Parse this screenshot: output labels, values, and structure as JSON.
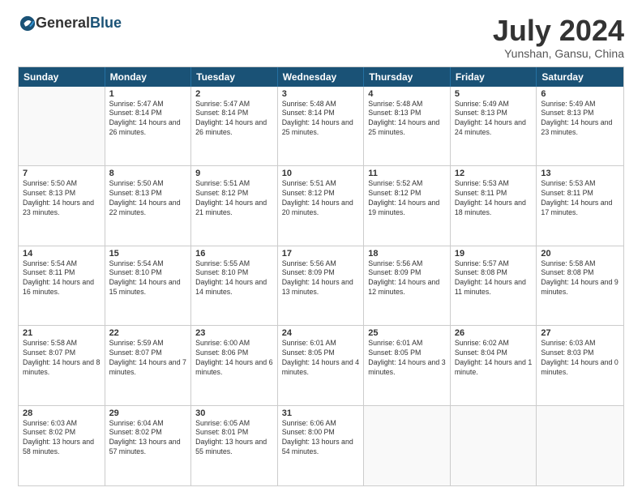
{
  "logo": {
    "general": "General",
    "blue": "Blue"
  },
  "title": "July 2024",
  "location": "Yunshan, Gansu, China",
  "days_of_week": [
    "Sunday",
    "Monday",
    "Tuesday",
    "Wednesday",
    "Thursday",
    "Friday",
    "Saturday"
  ],
  "weeks": [
    [
      {
        "day": "",
        "empty": true
      },
      {
        "day": "1",
        "sunrise": "5:47 AM",
        "sunset": "8:14 PM",
        "daylight": "14 hours and 26 minutes."
      },
      {
        "day": "2",
        "sunrise": "5:47 AM",
        "sunset": "8:14 PM",
        "daylight": "14 hours and 26 minutes."
      },
      {
        "day": "3",
        "sunrise": "5:48 AM",
        "sunset": "8:14 PM",
        "daylight": "14 hours and 25 minutes."
      },
      {
        "day": "4",
        "sunrise": "5:48 AM",
        "sunset": "8:13 PM",
        "daylight": "14 hours and 25 minutes."
      },
      {
        "day": "5",
        "sunrise": "5:49 AM",
        "sunset": "8:13 PM",
        "daylight": "14 hours and 24 minutes."
      },
      {
        "day": "6",
        "sunrise": "5:49 AM",
        "sunset": "8:13 PM",
        "daylight": "14 hours and 23 minutes."
      }
    ],
    [
      {
        "day": "7",
        "sunrise": "5:50 AM",
        "sunset": "8:13 PM",
        "daylight": "14 hours and 23 minutes."
      },
      {
        "day": "8",
        "sunrise": "5:50 AM",
        "sunset": "8:13 PM",
        "daylight": "14 hours and 22 minutes."
      },
      {
        "day": "9",
        "sunrise": "5:51 AM",
        "sunset": "8:12 PM",
        "daylight": "14 hours and 21 minutes."
      },
      {
        "day": "10",
        "sunrise": "5:51 AM",
        "sunset": "8:12 PM",
        "daylight": "14 hours and 20 minutes."
      },
      {
        "day": "11",
        "sunrise": "5:52 AM",
        "sunset": "8:12 PM",
        "daylight": "14 hours and 19 minutes."
      },
      {
        "day": "12",
        "sunrise": "5:53 AM",
        "sunset": "8:11 PM",
        "daylight": "14 hours and 18 minutes."
      },
      {
        "day": "13",
        "sunrise": "5:53 AM",
        "sunset": "8:11 PM",
        "daylight": "14 hours and 17 minutes."
      }
    ],
    [
      {
        "day": "14",
        "sunrise": "5:54 AM",
        "sunset": "8:11 PM",
        "daylight": "14 hours and 16 minutes."
      },
      {
        "day": "15",
        "sunrise": "5:54 AM",
        "sunset": "8:10 PM",
        "daylight": "14 hours and 15 minutes."
      },
      {
        "day": "16",
        "sunrise": "5:55 AM",
        "sunset": "8:10 PM",
        "daylight": "14 hours and 14 minutes."
      },
      {
        "day": "17",
        "sunrise": "5:56 AM",
        "sunset": "8:09 PM",
        "daylight": "14 hours and 13 minutes."
      },
      {
        "day": "18",
        "sunrise": "5:56 AM",
        "sunset": "8:09 PM",
        "daylight": "14 hours and 12 minutes."
      },
      {
        "day": "19",
        "sunrise": "5:57 AM",
        "sunset": "8:08 PM",
        "daylight": "14 hours and 11 minutes."
      },
      {
        "day": "20",
        "sunrise": "5:58 AM",
        "sunset": "8:08 PM",
        "daylight": "14 hours and 9 minutes."
      }
    ],
    [
      {
        "day": "21",
        "sunrise": "5:58 AM",
        "sunset": "8:07 PM",
        "daylight": "14 hours and 8 minutes."
      },
      {
        "day": "22",
        "sunrise": "5:59 AM",
        "sunset": "8:07 PM",
        "daylight": "14 hours and 7 minutes."
      },
      {
        "day": "23",
        "sunrise": "6:00 AM",
        "sunset": "8:06 PM",
        "daylight": "14 hours and 6 minutes."
      },
      {
        "day": "24",
        "sunrise": "6:01 AM",
        "sunset": "8:05 PM",
        "daylight": "14 hours and 4 minutes."
      },
      {
        "day": "25",
        "sunrise": "6:01 AM",
        "sunset": "8:05 PM",
        "daylight": "14 hours and 3 minutes."
      },
      {
        "day": "26",
        "sunrise": "6:02 AM",
        "sunset": "8:04 PM",
        "daylight": "14 hours and 1 minute."
      },
      {
        "day": "27",
        "sunrise": "6:03 AM",
        "sunset": "8:03 PM",
        "daylight": "14 hours and 0 minutes."
      }
    ],
    [
      {
        "day": "28",
        "sunrise": "6:03 AM",
        "sunset": "8:02 PM",
        "daylight": "13 hours and 58 minutes."
      },
      {
        "day": "29",
        "sunrise": "6:04 AM",
        "sunset": "8:02 PM",
        "daylight": "13 hours and 57 minutes."
      },
      {
        "day": "30",
        "sunrise": "6:05 AM",
        "sunset": "8:01 PM",
        "daylight": "13 hours and 55 minutes."
      },
      {
        "day": "31",
        "sunrise": "6:06 AM",
        "sunset": "8:00 PM",
        "daylight": "13 hours and 54 minutes."
      },
      {
        "day": "",
        "empty": true
      },
      {
        "day": "",
        "empty": true
      },
      {
        "day": "",
        "empty": true
      }
    ]
  ]
}
